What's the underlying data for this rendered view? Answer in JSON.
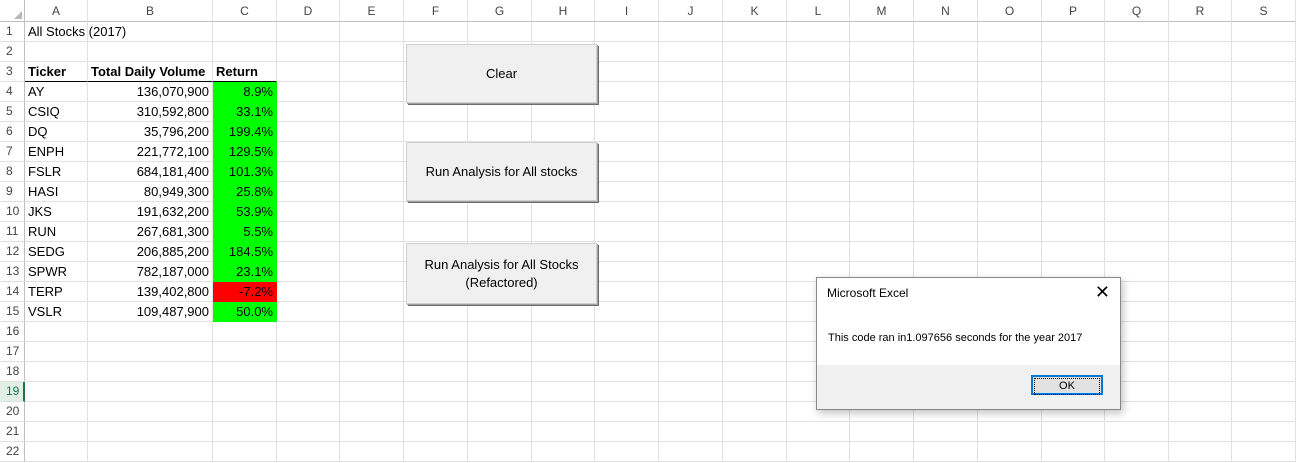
{
  "columns": [
    "A",
    "B",
    "C",
    "D",
    "E",
    "F",
    "G",
    "H",
    "I",
    "J",
    "K",
    "L",
    "M",
    "N",
    "O",
    "P",
    "Q",
    "R",
    "S"
  ],
  "rows": [
    "1",
    "2",
    "3",
    "4",
    "5",
    "6",
    "7",
    "8",
    "9",
    "10",
    "11",
    "12",
    "13",
    "14",
    "15",
    "16",
    "17",
    "18",
    "19",
    "20",
    "21",
    "22"
  ],
  "sheet": {
    "title": "All Stocks (2017)",
    "headers": {
      "ticker": "Ticker",
      "volume": "Total Daily Volume",
      "return": "Return"
    },
    "data": [
      {
        "ticker": "AY",
        "volume": "136,070,900",
        "return": "8.9%",
        "status": "positive"
      },
      {
        "ticker": "CSIQ",
        "volume": "310,592,800",
        "return": "33.1%",
        "status": "positive"
      },
      {
        "ticker": "DQ",
        "volume": "35,796,200",
        "return": "199.4%",
        "status": "positive"
      },
      {
        "ticker": "ENPH",
        "volume": "221,772,100",
        "return": "129.5%",
        "status": "positive"
      },
      {
        "ticker": "FSLR",
        "volume": "684,181,400",
        "return": "101.3%",
        "status": "positive"
      },
      {
        "ticker": "HASI",
        "volume": "80,949,300",
        "return": "25.8%",
        "status": "positive"
      },
      {
        "ticker": "JKS",
        "volume": "191,632,200",
        "return": "53.9%",
        "status": "positive"
      },
      {
        "ticker": "RUN",
        "volume": "267,681,300",
        "return": "5.5%",
        "status": "positive"
      },
      {
        "ticker": "SEDG",
        "volume": "206,885,200",
        "return": "184.5%",
        "status": "positive"
      },
      {
        "ticker": "SPWR",
        "volume": "782,187,000",
        "return": "23.1%",
        "status": "positive"
      },
      {
        "ticker": "TERP",
        "volume": "139,402,800",
        "return": "-7.2%",
        "status": "negative"
      },
      {
        "ticker": "VSLR",
        "volume": "109,487,900",
        "return": "50.0%",
        "status": "positive"
      }
    ]
  },
  "buttons": {
    "clear": "Clear",
    "run_all": "Run Analysis for All stocks",
    "run_refactored_line1": "Run Analysis for All Stocks",
    "run_refactored_line2": "(Refactored)"
  },
  "dialog": {
    "title": "Microsoft Excel",
    "close_glyph": "✕",
    "message": "This code ran in1.097656 seconds for the year 2017",
    "ok": "OK"
  },
  "selected_row": "19",
  "colors": {
    "positive": "#00ff00",
    "negative": "#ff0000",
    "accent": "#217346"
  }
}
